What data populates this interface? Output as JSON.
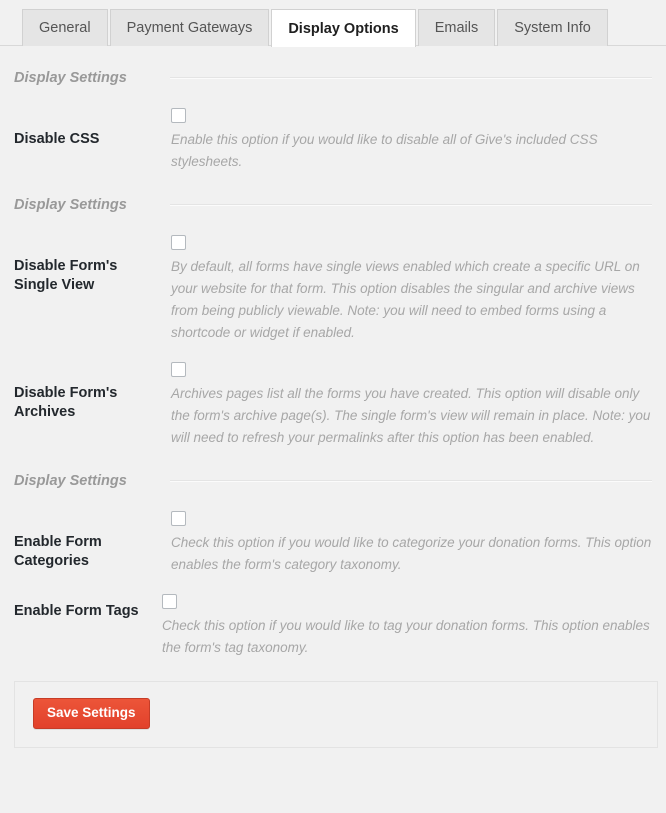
{
  "tabs": [
    {
      "label": "General",
      "active": false
    },
    {
      "label": "Payment Gateways",
      "active": false
    },
    {
      "label": "Display Options",
      "active": true
    },
    {
      "label": "Emails",
      "active": false
    },
    {
      "label": "System Info",
      "active": false
    }
  ],
  "sections": [
    {
      "title": "Display Settings",
      "fields": [
        {
          "label": "Disable CSS",
          "checked": false,
          "description": "Enable this option if you would like to disable all of Give's included CSS stylesheets."
        }
      ]
    },
    {
      "title": "Display Settings",
      "fields": [
        {
          "label": "Disable Form's Single View",
          "checked": false,
          "description": "By default, all forms have single views enabled which create a specific URL on your website for that form. This option disables the singular and archive views from being publicly viewable. Note: you will need to embed forms using a shortcode or widget if enabled."
        },
        {
          "label": "Disable Form's Archives",
          "checked": false,
          "description": "Archives pages list all the forms you have created. This option will disable only the form's archive page(s). The single form's view will remain in place. Note: you will need to refresh your permalinks after this option has been enabled."
        }
      ]
    },
    {
      "title": "Display Settings",
      "fields": [
        {
          "label": "Enable Form Categories",
          "checked": false,
          "description": "Check this option if you would like to categorize your donation forms. This option enables the form's category taxonomy."
        },
        {
          "label": "Enable Form Tags",
          "checked": false,
          "description": "Check this option if you would like to tag your donation forms. This option enables the form's tag taxonomy."
        }
      ]
    }
  ],
  "save": {
    "label": "Save Settings"
  },
  "colors": {
    "page_background": "#f1f1f1",
    "active_tab_background": "#ffffff",
    "inactive_tab_background": "#e5e5e5",
    "save_button": "#e84b33",
    "label_text": "#23282d",
    "description_text": "#a7a7a7",
    "section_title_text": "#999999"
  }
}
